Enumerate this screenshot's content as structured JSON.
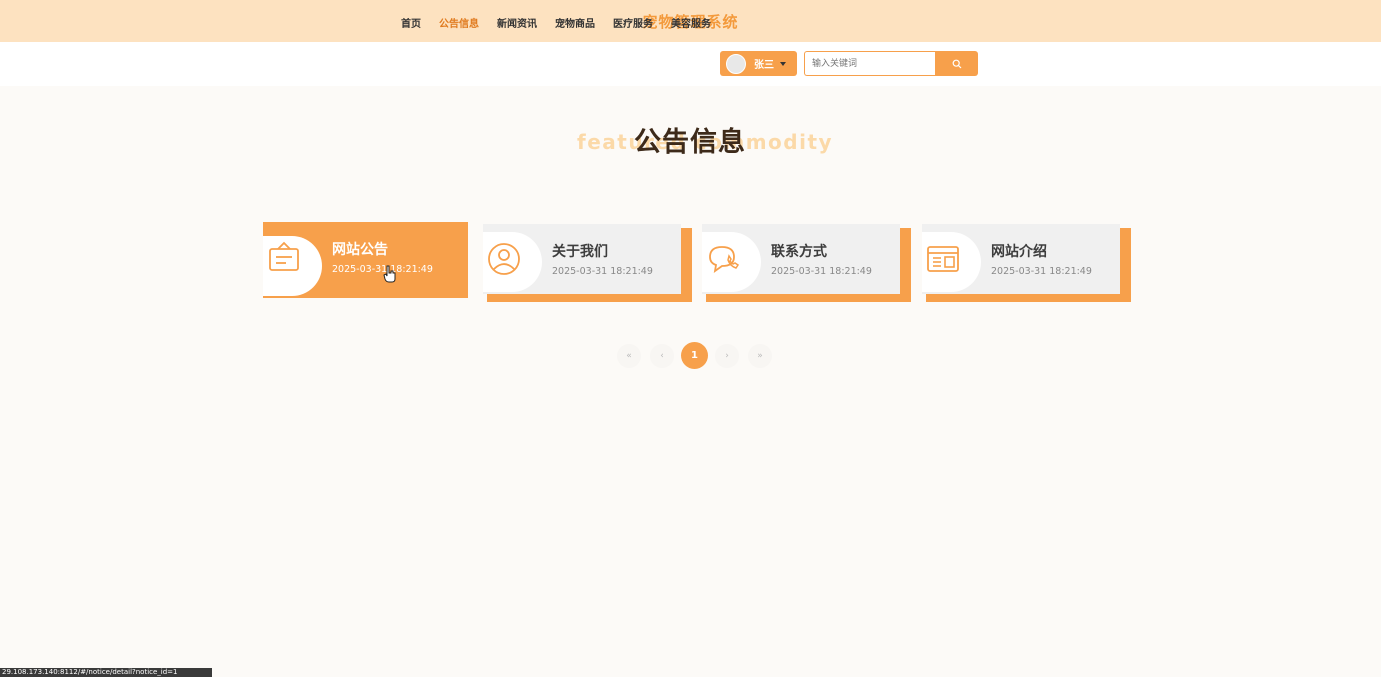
{
  "header": {
    "site_title": "宠物管理系统"
  },
  "nav": {
    "items": [
      {
        "label": "首页",
        "active": false
      },
      {
        "label": "公告信息",
        "active": true
      },
      {
        "label": "新闻资讯",
        "active": false
      },
      {
        "label": "宠物商品",
        "active": false
      },
      {
        "label": "医疗服务",
        "active": false
      },
      {
        "label": "美容服务",
        "active": false
      }
    ],
    "user_name": "张三",
    "search_placeholder": "输入关键词"
  },
  "section": {
    "title": "公告信息",
    "subtitle_bg": "featured commodity"
  },
  "cards": [
    {
      "title": "网站公告",
      "date": "2025-03-31 18:21:49",
      "icon": "notice-board-icon"
    },
    {
      "title": "关于我们",
      "date": "2025-03-31 18:21:49",
      "icon": "user-circle-icon"
    },
    {
      "title": "联系方式",
      "date": "2025-03-31 18:21:49",
      "icon": "phone-chat-icon"
    },
    {
      "title": "网站介绍",
      "date": "2025-03-31 18:21:49",
      "icon": "browser-window-icon"
    }
  ],
  "pagination": {
    "first": "«",
    "prev": "‹",
    "current": "1",
    "next": "›",
    "last": "»"
  },
  "status_bar": {
    "url": "29.108.173.140:8112/#/notice/detail?notice_id=1"
  },
  "colors": {
    "accent": "#f7a04b",
    "header_bg": "#fde2c0",
    "active_nav": "#e07b1f"
  }
}
